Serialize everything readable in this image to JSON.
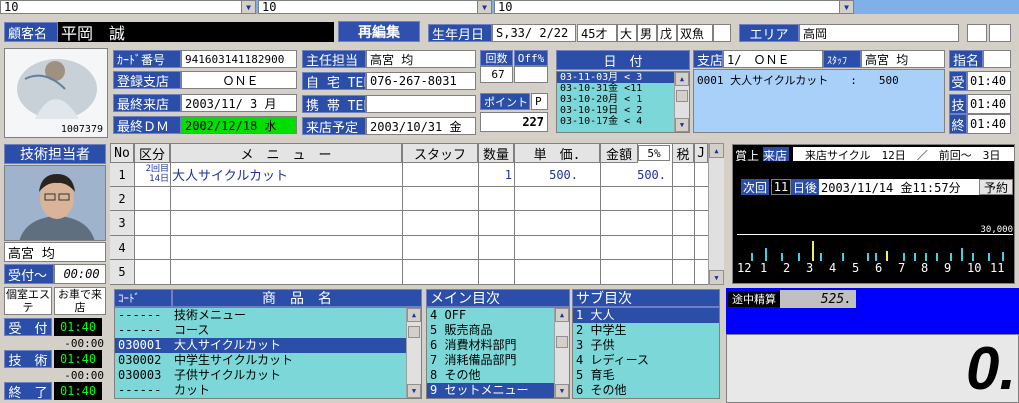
{
  "top_dropdowns": [
    "10",
    "10",
    "10"
  ],
  "customer": {
    "label": "顧客名",
    "name": "平岡　誠",
    "reedit": "再編集",
    "birth_label": "生年月日",
    "birth": "S,33/ 2/22",
    "age": "45才",
    "size": "大",
    "sex": "男",
    "zodiac": "戊",
    "constellation": "双魚",
    "area_label": "エリア",
    "area": "高岡"
  },
  "photo_caption": "1007379",
  "card": {
    "card_label": "ｶｰﾄﾞ番号",
    "card_no": "941603141182900",
    "store_label": "登録支店",
    "store": "ＯＮＥ",
    "last_visit_label": "最終来店",
    "last_visit": "2003/11/ 3 月",
    "last_dm_label": "最終ＤＭ",
    "last_dm": "2002/12/18 水"
  },
  "contact": {
    "main_staff_label": "主任担当",
    "main_staff": "高宮 均",
    "home_label": "自 宅 TEL",
    "home": "076-267-8031",
    "mobile_label": "携 帯 TEL",
    "mobile": "",
    "planned_label": "来店予定",
    "planned": "2003/10/31 金"
  },
  "counts": {
    "visits_label": "回数",
    "off_label": "Off%",
    "visits": "67",
    "points_label": "ポイント",
    "points_flag": "P",
    "points": "227"
  },
  "dates": {
    "header": "日　付",
    "items": [
      "03-11-03月 < 3",
      "03-10-31金 <11",
      "03-10-20月 < 1",
      "03-10-19日 < 2",
      "03-10-17金 < 4"
    ]
  },
  "history": {
    "branch_label": "支店",
    "branch": "1/　ＯＮＥ",
    "staff_label": "ｽﾀｯﾌ",
    "staff": "高宮 均",
    "line": "0001 大人サイクルカット　　:　　500"
  },
  "nomination": {
    "label": "指名",
    "recv_label": "受",
    "recv": "01:40",
    "tech_label": "技",
    "tech": "01:40",
    "end_label": "終",
    "end": "01:40"
  },
  "tech_staff": {
    "label": "技術担当者",
    "name": "高宮 均",
    "accept_label": "受付～",
    "accept_time": "00:00"
  },
  "menu_table": {
    "headers": [
      "No",
      "区分",
      "メ　ニ　ュ　ー",
      "スタッフ",
      "数量",
      "単　価.",
      "金額",
      "5%",
      "税",
      "J"
    ],
    "row1": {
      "no": "1",
      "kubun_top": "2回目",
      "kubun_bot": "14日",
      "menu": "大人サイクルカット",
      "qty": "1",
      "price": "500.",
      "amount": "500."
    },
    "row_nums": [
      "2",
      "3",
      "4",
      "5"
    ]
  },
  "cycle": {
    "title_a": "賞上",
    "title_b": "来店",
    "title_c": "来店サイクル　12日　／　前回～　3日",
    "next_label": "次回",
    "next_days": "11",
    "after_label": "日後",
    "next_date": "2003/11/14 金11:57分",
    "reserve": "予約",
    "max_label": "30,000",
    "months": [
      "12",
      "1",
      "2",
      "3",
      "4",
      "5",
      "6",
      "7",
      "8",
      "9",
      "10",
      "11"
    ],
    "bars": [
      {
        "m": 0.05,
        "v": 0.3,
        "c": "#40d0e0"
      },
      {
        "m": 0.1,
        "v": 0.5,
        "c": "#40d0e0"
      },
      {
        "m": 0.16,
        "v": 0.3,
        "c": "#40d0e0"
      },
      {
        "m": 0.22,
        "v": 0.3,
        "c": "#40d0e0"
      },
      {
        "m": 0.27,
        "v": 0.75,
        "c": "#f0f060"
      },
      {
        "m": 0.3,
        "v": 0.3,
        "c": "#40d0e0"
      },
      {
        "m": 0.38,
        "v": 0.3,
        "c": "#40d0e0"
      },
      {
        "m": 0.47,
        "v": 0.3,
        "c": "#40d0e0"
      },
      {
        "m": 0.5,
        "v": 0.3,
        "c": "#40d0e0"
      },
      {
        "m": 0.54,
        "v": 0.4,
        "c": "#f0f060"
      },
      {
        "m": 0.6,
        "v": 0.3,
        "c": "#40d0e0"
      },
      {
        "m": 0.64,
        "v": 0.3,
        "c": "#40d0e0"
      },
      {
        "m": 0.68,
        "v": 0.3,
        "c": "#40d0e0"
      },
      {
        "m": 0.72,
        "v": 0.3,
        "c": "#40d0e0"
      },
      {
        "m": 0.77,
        "v": 0.3,
        "c": "#40d0e0"
      },
      {
        "m": 0.81,
        "v": 0.5,
        "c": "#40d0e0"
      },
      {
        "m": 0.85,
        "v": 0.3,
        "c": "#40d0e0"
      },
      {
        "m": 0.91,
        "v": 0.3,
        "c": "#40d0e0"
      },
      {
        "m": 0.96,
        "v": 0.35,
        "c": "#40d0e0"
      }
    ]
  },
  "left_status": {
    "room_label": "個室エステ",
    "car_label": "お車で来店",
    "accept_label": "受　付",
    "accept": "01:40",
    "t1": "-00:00",
    "tech_label": "技　術",
    "tech": "01:40",
    "t2": "-00:00",
    "end_label": "終　了",
    "end": "01:40"
  },
  "products": {
    "code_label": "ｺｰﾄﾞ",
    "name_label": "商　品　名",
    "items": [
      {
        "code": "------",
        "name": "技術メニュー"
      },
      {
        "code": "------",
        "name": "コース"
      },
      {
        "code": "030001",
        "name": "大人サイクルカット"
      },
      {
        "code": "030002",
        "name": "中学生サイクルカット"
      },
      {
        "code": "030003",
        "name": "子供サイクルカット"
      },
      {
        "code": "------",
        "name": "カット"
      }
    ]
  },
  "main_idx": {
    "label": "メイン目次",
    "items": [
      "4 OFF",
      "5 販売商品",
      "6 消費材料部門",
      "7 消耗備品部門",
      "8 その他",
      "9 セットメニュー"
    ]
  },
  "sub_idx": {
    "label": "サブ目次",
    "items": [
      "1 大人",
      "2 中学生",
      "3 子供",
      "4 レディース",
      "5 育毛",
      "6 その他"
    ]
  },
  "subtotal": {
    "label": "途中精算",
    "value": "525.",
    "big": "0."
  }
}
